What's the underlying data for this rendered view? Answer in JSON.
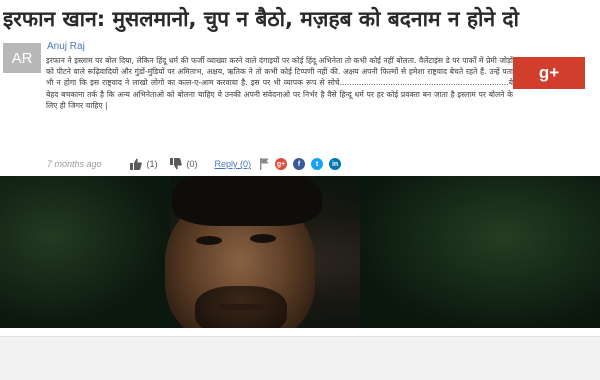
{
  "article": {
    "headline": "इरफान खान: मुसलमानो, चुप न बैठो, मज़हब को बदनाम न होने दो"
  },
  "comment": {
    "avatar_initials": "AR",
    "author": "Anuj Raj",
    "text": "इरफान ने इस्लाम पर बोल दिया, लेकिन हिंदू धर्म की फर्जी व्याख्या करने वाले दंगाइयों पर कोई हिंदू अभिनेता तो कभी कोई नहीं बोलता. वैलेंटाइंस डे पर पार्कों में प्रेमी जोड़ों को पीटने वाले रूढ़िवादियों और गुंडों-मुंडियों पर अमिताभ, अक्षय, ऋतिक ने तो कभी कोई टिप्पणी नहीं की. अक्षय अपनी फिल्मों से हमेशा राष्ट्रवाद बेचते रहते हैं. उन्हें पता भी न होगा कि इस राष्ट्रवाद ने लाखो लोगो का कत्ल-ए-आम करवाया है. इस पर भी व्यापक रूप से सोचे......................................................................ये बेहद बचकाना तर्क है कि अन्य अभिनेताओ को बोलना चाहिए ये उनकी अपनी संवेदनाओ पर निर्भर है वैसे हिन्दू धर्म पर हर कोई प्रवक्ता बन जाता है इस्लाम पर बोलने के लिए ही जिगर चाहिए |",
    "time_ago": "7 months ago",
    "likes": "(1)",
    "dislikes": "(0)",
    "reply_label": "Reply (0)",
    "share_icons": [
      "google-plus-icon",
      "facebook-icon",
      "twitter-icon",
      "linkedin-icon"
    ],
    "share_colors": {
      "google-plus": "#dd4b39",
      "facebook": "#3b5998",
      "twitter": "#1da1f2",
      "linkedin": "#0077b5"
    }
  },
  "sidebar": {
    "gplus_label": "g+",
    "gplus_color": "#d23e2c"
  },
  "colors": {
    "author_link": "#4a76b8",
    "avatar_bg": "#b8b8b8",
    "headline": "#2a2a2a"
  }
}
